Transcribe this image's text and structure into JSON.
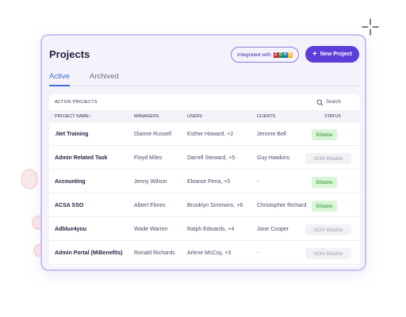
{
  "title": "Projects",
  "integration": {
    "label": "Integrated with",
    "logo_letters": [
      "Z",
      "O",
      "H",
      "O"
    ],
    "logo_colors": [
      "#e42527",
      "#089949",
      "#226db4",
      "#f9b21d"
    ]
  },
  "new_project_label": "New Project",
  "tabs": [
    {
      "label": "Active",
      "active": true
    },
    {
      "label": "Archived",
      "active": false
    }
  ],
  "table": {
    "title": "ACTIVE PROJECTS",
    "search_label": "Search",
    "columns": [
      "PROJECT NAME↑",
      "MANAGERS",
      "USERS",
      "CLIENTS",
      "STATUS"
    ],
    "rows": [
      {
        "name": ".Net Training",
        "manager": "Dianne Russell",
        "users": "Esther Howard, +2",
        "client": "Jerome Bell",
        "status": "Billable"
      },
      {
        "name": "Admin Related Task",
        "manager": "Floyd Miles",
        "users": "Darrell Steward, +5",
        "client": "Guy Hawkins",
        "status": "NON Billable"
      },
      {
        "name": "Accounting",
        "manager": "Jenny Wilson",
        "users": "Eleanor Pena, +5",
        "client": "-",
        "status": "Billable"
      },
      {
        "name": "ACSA SSO",
        "manager": "Albert Flores",
        "users": "Brooklyn Simmons, +6",
        "client": "Christopher Richard",
        "status": "Billable"
      },
      {
        "name": "Adblue4you",
        "manager": "Wade Warren",
        "users": "Ralph Edwards, +4",
        "client": "Jane Cooper",
        "status": "NON Billable"
      },
      {
        "name": "Admin Portal (MiBenefits)",
        "manager": "Ronald Richards",
        "users": "Arlene McCoy, +3",
        "client": "-",
        "status": "NON Billable"
      }
    ]
  },
  "colors": {
    "accent": "#5b3fd8",
    "tab_active": "#3b6fd8",
    "billable_bg": "#d8f5d8",
    "billable_text": "#3a9a3a",
    "non_billable_text": "#a0a2b0"
  }
}
